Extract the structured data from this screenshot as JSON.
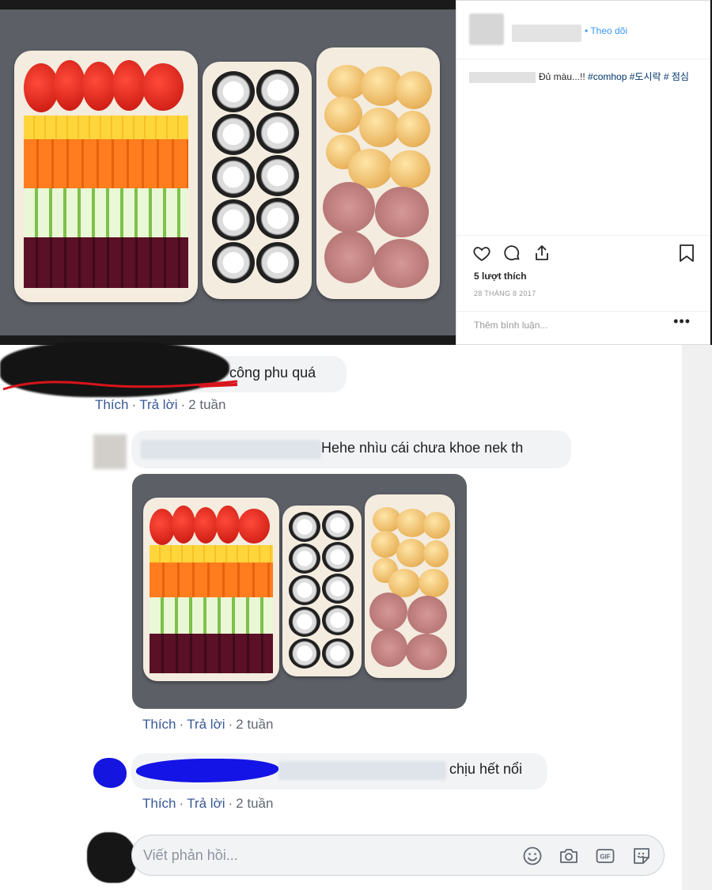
{
  "instagram": {
    "follow_label": "• Theo dõi",
    "caption": {
      "text": "Đủ màu...!! ",
      "tags": "#comhop #도시락 # 점심"
    },
    "likes": "5 lượt thích",
    "date": "28 THÁNG 8 2017",
    "add_comment_placeholder": "Thêm bình luận...",
    "more_label": "•••",
    "icons": [
      "heart-icon",
      "comment-icon",
      "share-icon",
      "bookmark-icon"
    ]
  },
  "comments": [
    {
      "text": "công phu quá",
      "actions": {
        "like": "Thích",
        "reply": "Trả lời",
        "time": "2 tuần"
      }
    },
    {
      "text": "Hehe nhìu cái chưa khoe nek th",
      "actions": {
        "like": "Thích",
        "reply": "Trả lời",
        "time": "2 tuần"
      }
    },
    {
      "text": "chịu hết nổi",
      "actions": {
        "like": "Thích",
        "reply": "Trả lời",
        "time": "2 tuần"
      }
    }
  ],
  "reply_box": {
    "placeholder": "Viết phản hồi...",
    "tools": [
      "emoji-icon",
      "camera-icon",
      "gif-icon",
      "sticker-icon"
    ],
    "gif_label": "GIF"
  },
  "colors": {
    "link_blue": "#385898",
    "ig_blue": "#3897f0",
    "bubble_bg": "#f2f3f5"
  }
}
